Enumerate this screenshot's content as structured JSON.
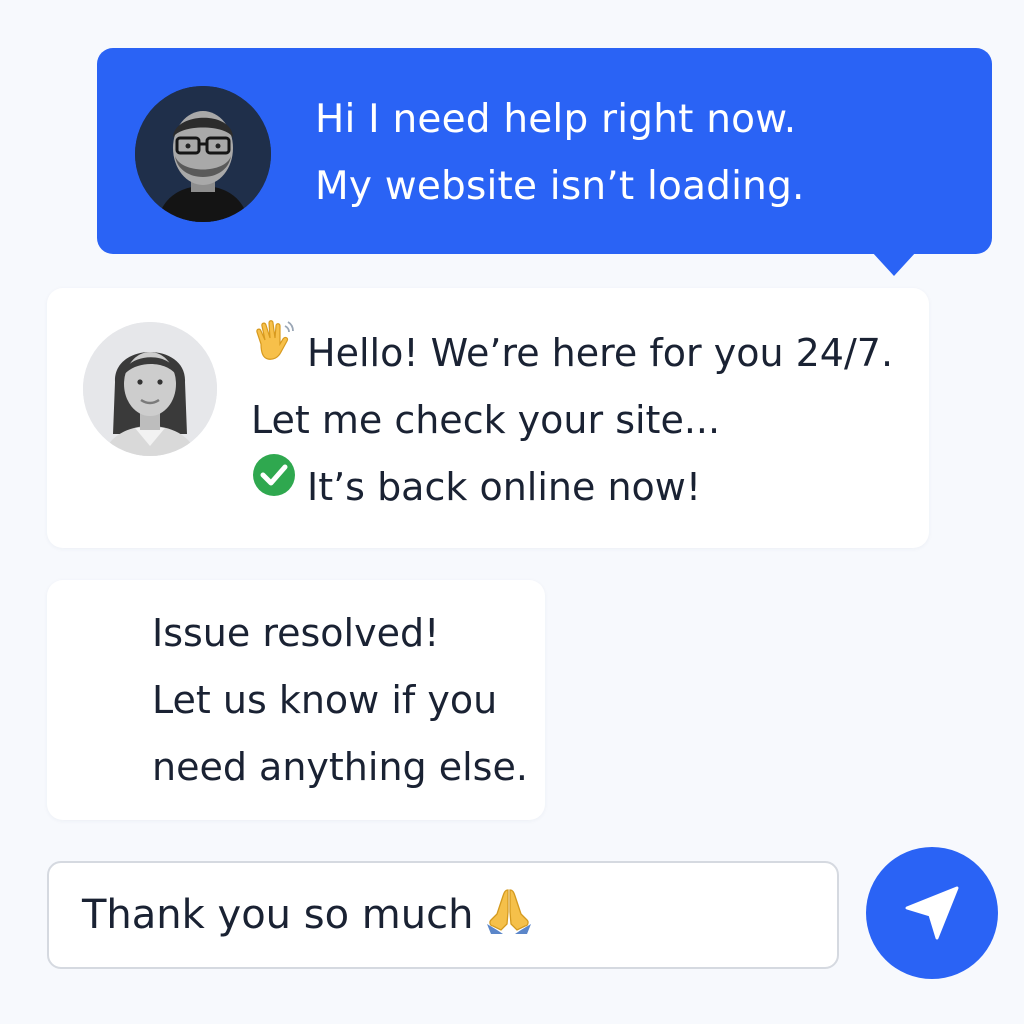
{
  "colors": {
    "accent": "#2a63f5",
    "background": "#f7f9fd",
    "bubble": "#ffffff",
    "text": "#1a2233",
    "input_border": "#d5d9e0"
  },
  "user_message": {
    "avatar_icon": "man-with-glasses-avatar",
    "lines": [
      "Hi I need help right now.",
      "My website isn’t loading."
    ]
  },
  "agent_message": {
    "avatar_icon": "woman-support-agent-avatar",
    "lines": [
      {
        "icon": "waving-hand-icon",
        "text": "Hello! We’re here for you 24/7."
      },
      {
        "icon": "",
        "text": "Let me check your site..."
      },
      {
        "icon": "check-mark-icon",
        "text": "It’s back online now!"
      }
    ]
  },
  "resolved_message": {
    "lines": [
      "Issue resolved!",
      "Let us know if you",
      "need anything else."
    ]
  },
  "composer": {
    "value": "Thank you so much",
    "value_icon": "folded-hands-icon",
    "send_icon": "paper-plane-send-icon"
  }
}
